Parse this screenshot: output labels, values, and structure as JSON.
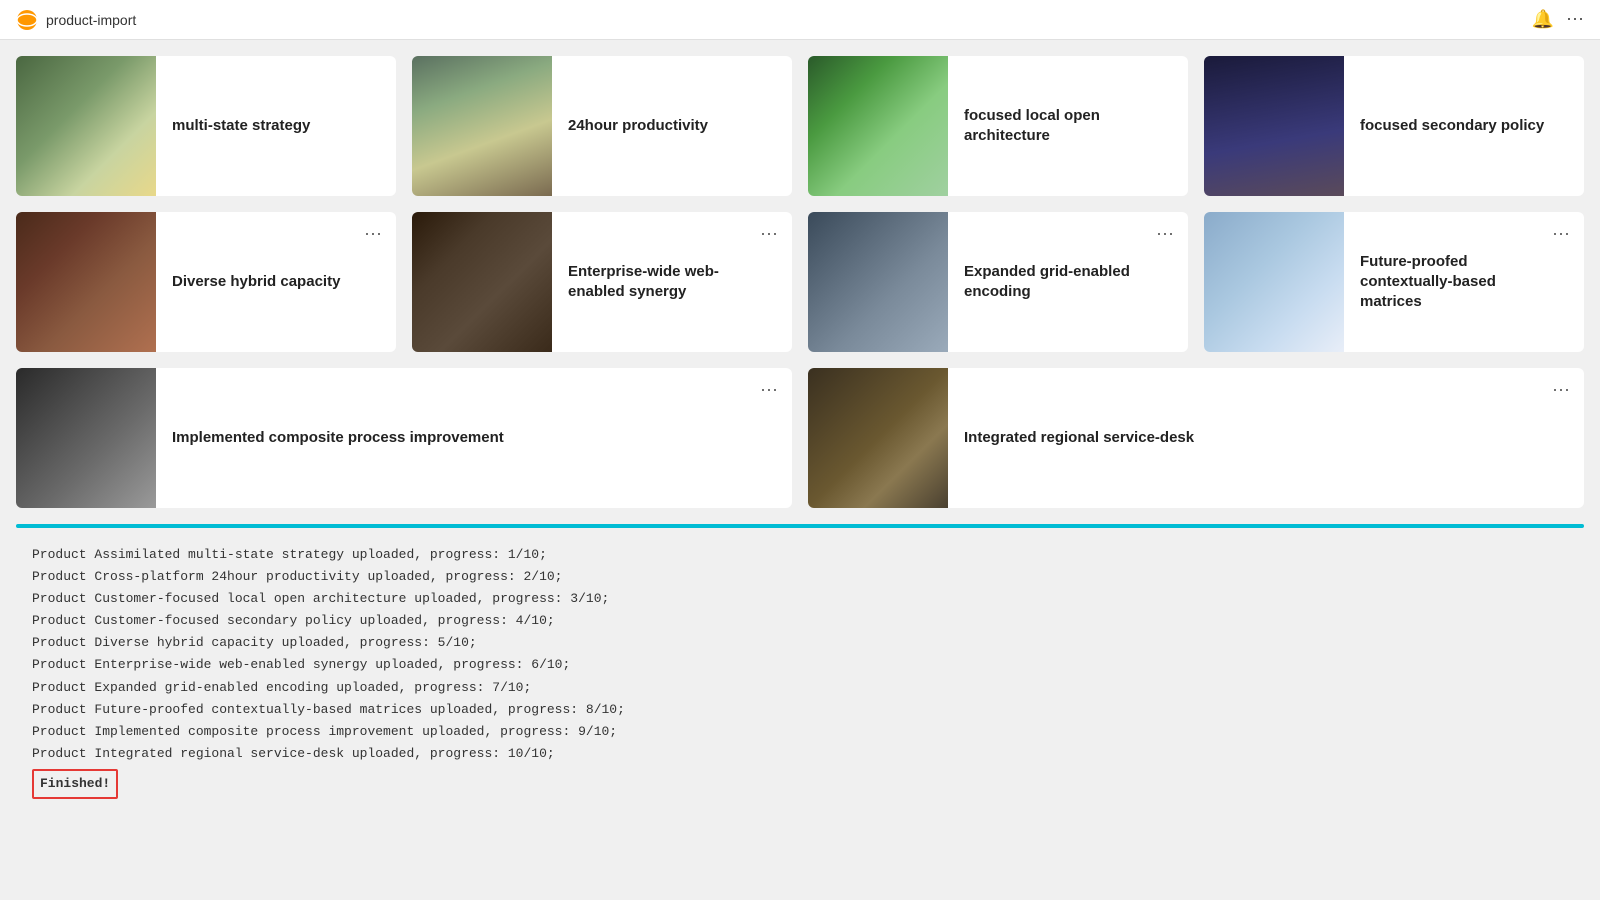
{
  "titlebar": {
    "app_name": "product-import",
    "bell_icon": "🔔",
    "more_icon": "⋯"
  },
  "cards": [
    {
      "id": "card-1",
      "title": "multi-state strategy",
      "img_class": "img-1",
      "has_menu": false
    },
    {
      "id": "card-2",
      "title": "24hour productivity",
      "img_class": "img-2",
      "has_menu": false
    },
    {
      "id": "card-3",
      "title": "focused local open architecture",
      "img_class": "img-3",
      "has_menu": false
    },
    {
      "id": "card-4",
      "title": "focused secondary policy",
      "img_class": "img-4",
      "has_menu": false
    },
    {
      "id": "card-5",
      "title": "Diverse hybrid capacity",
      "img_class": "img-5",
      "has_menu": true
    },
    {
      "id": "card-6",
      "title": "Enterprise-wide web-enabled synergy",
      "img_class": "img-6",
      "has_menu": true
    },
    {
      "id": "card-7",
      "title": "Expanded grid-enabled encoding",
      "img_class": "img-7",
      "has_menu": true
    },
    {
      "id": "card-8",
      "title": "Future-proofed contextually-based matrices",
      "img_class": "img-8",
      "has_menu": true
    },
    {
      "id": "card-9",
      "title": "Implemented composite process improvement",
      "img_class": "img-9",
      "has_menu": true
    },
    {
      "id": "card-10",
      "title": "Integrated regional service-desk",
      "img_class": "img-10",
      "has_menu": true
    }
  ],
  "log": {
    "lines": [
      "Product Assimilated multi-state strategy uploaded, progress: 1/10;",
      "Product Cross-platform 24hour productivity uploaded, progress: 2/10;",
      "Product Customer-focused local open architecture uploaded, progress: 3/10;",
      "Product Customer-focused secondary policy uploaded, progress: 4/10;",
      "Product Diverse hybrid capacity uploaded, progress: 5/10;",
      "Product Enterprise-wide web-enabled synergy uploaded, progress: 6/10;",
      "Product Expanded grid-enabled encoding uploaded, progress: 7/10;",
      "Product Future-proofed contextually-based matrices uploaded, progress: 8/10;",
      "Product Implemented composite process improvement uploaded, progress: 9/10;",
      "Product Integrated regional service-desk uploaded, progress: 10/10;"
    ],
    "finished_label": "Finished!"
  },
  "menu_label": "⋯"
}
